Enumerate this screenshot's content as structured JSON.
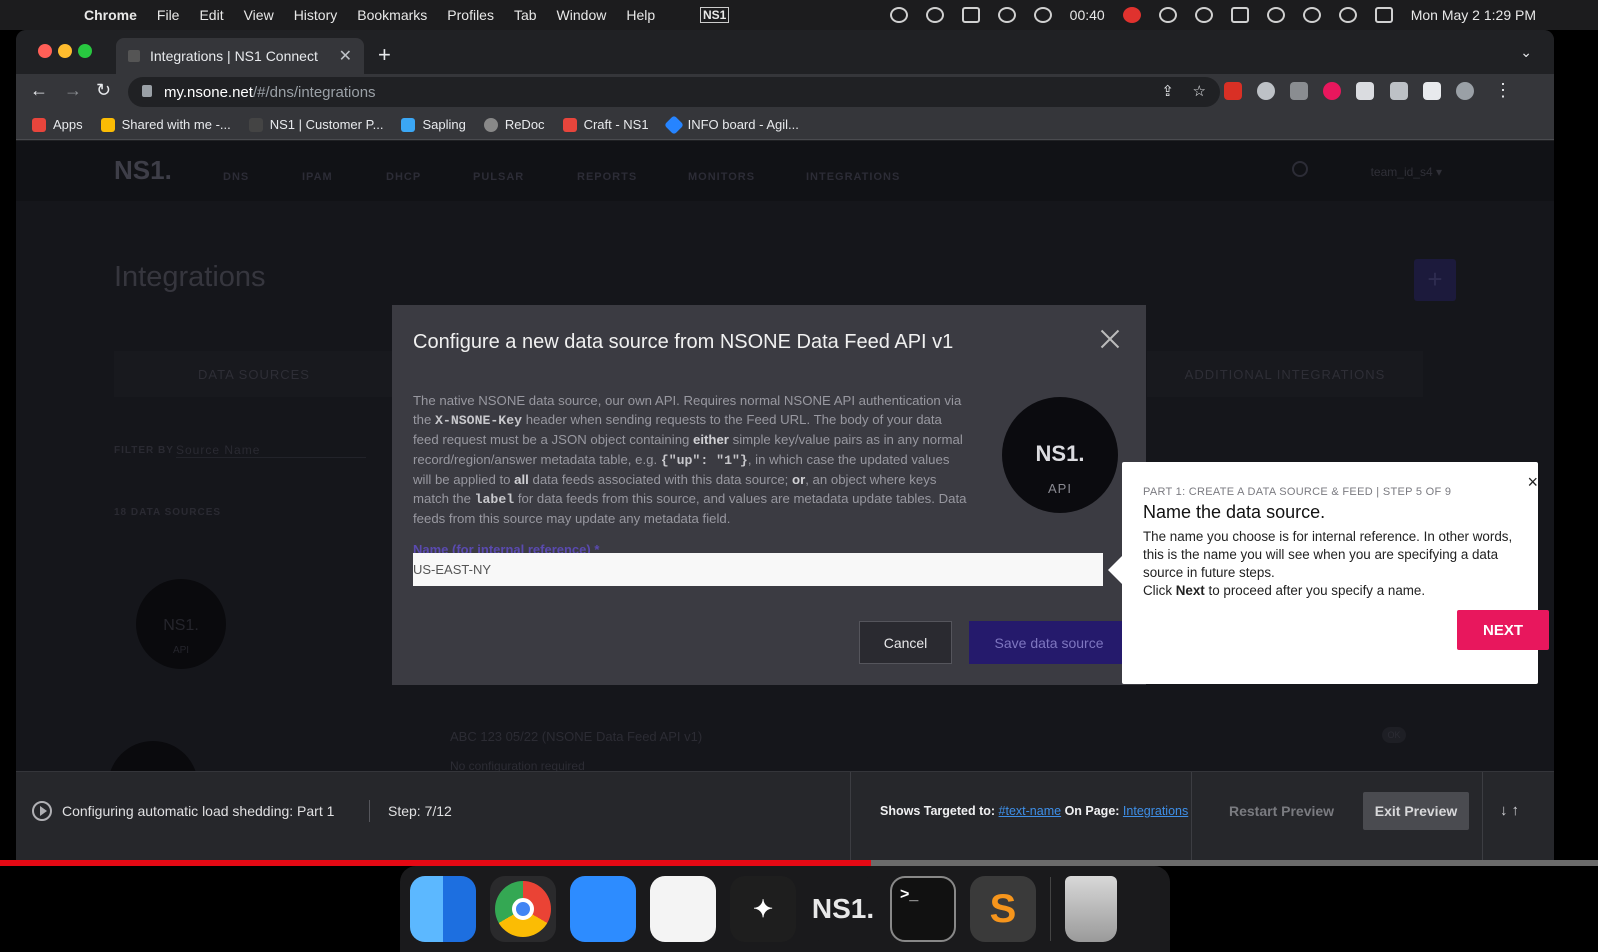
{
  "menubar": {
    "app": "Chrome",
    "items": [
      "File",
      "Edit",
      "View",
      "History",
      "Bookmarks",
      "Profiles",
      "Tab",
      "Window",
      "Help"
    ],
    "ns1_badge": "NS1",
    "timer": "00:40",
    "datetime": "Mon May 2  1:29 PM"
  },
  "browser": {
    "tab_title": "Integrations | NS1 Connect",
    "url_host": "my.nsone.net",
    "url_path": "/#/dns/integrations",
    "bookmarks": [
      "Apps",
      "Shared with me -...",
      "NS1 | Customer P...",
      "Sapling",
      "ReDoc",
      "Craft - NS1",
      "INFO board - Agil..."
    ]
  },
  "page": {
    "logo": "NS1.",
    "nav": [
      "DNS",
      "IPAM",
      "DHCP",
      "PULSAR",
      "REPORTS",
      "MONITORS",
      "INTEGRATIONS"
    ],
    "team": "team_id_s4 ▾",
    "title": "Integrations",
    "add_button": "+",
    "tab_data_sources": "DATA SOURCES",
    "tab_additional": "ADDITIONAL INTEGRATIONS",
    "filter_label": "FILTER BY",
    "filter_placeholder": "Source Name",
    "count_label": "18 DATA SOURCES",
    "bg_row_title": "ABC 123 05/22 (NSONE Data Feed API v1)",
    "bg_row_sub": "No configuration required",
    "bg_badge_ns1": "NS1.",
    "bg_badge_api": "API",
    "bg_pill": "OK"
  },
  "modal": {
    "title": "Configure a new data source from NSONE Data Feed API v1",
    "desc_1": "The native NSONE data source, our own API. Requires normal NSONE API authentication via the ",
    "desc_code_1": "X-NSONE-Key",
    "desc_2": " header when sending requests to the Feed URL. The body of your data feed request must be a JSON object containing ",
    "desc_bold_1": "either",
    "desc_3": " simple key/value pairs as in any normal record/region/answer metadata table, e.g. ",
    "desc_code_2": "{\"up\": \"1\"}",
    "desc_4": ", in which case the updated values will be applied to ",
    "desc_bold_2": "all",
    "desc_5": " data feeds associated with this data source; ",
    "desc_bold_3": "or",
    "desc_6": ", an object where keys match the ",
    "desc_code_3": "label",
    "desc_7": " for data feeds from this source, and values are metadata update tables. Data feeds from this source may update any metadata field.",
    "badge_ns1": "NS1.",
    "badge_api": "API",
    "name_label": "Name (for internal reference) *",
    "name_value": "US-EAST-NY",
    "cancel": "Cancel",
    "save": "Save data source"
  },
  "tour": {
    "step": "PART 1: CREATE A DATA SOURCE & FEED | STEP 5 OF 9",
    "title": "Name the data source.",
    "body_1": "The name you choose is for internal reference. In other words, this is the name you will see when you are specifying a data source in future steps.",
    "body_2a": "Click ",
    "body_2b": "Next",
    "body_2c": " to proceed after you specify a name.",
    "next": "NEXT",
    "close": "×"
  },
  "footer": {
    "flow_name": "Configuring automatic load shedding: Part 1",
    "step": "Step: 7/12",
    "targeted_label": "Shows Targeted to:",
    "targeted_value": "#text-name",
    "on_page_label": "On Page:",
    "on_page_value": "Integrations",
    "restart": "Restart Preview",
    "exit": "Exit Preview",
    "arrows": "↓↑"
  },
  "video_progress": 0.545,
  "dock": {
    "ns1_label": "NS1."
  },
  "colors": {
    "accent_pink": "#e8175d",
    "save_purple": "#251a6c",
    "link_blue": "#3e8fe8",
    "progress_red": "#e50914"
  }
}
